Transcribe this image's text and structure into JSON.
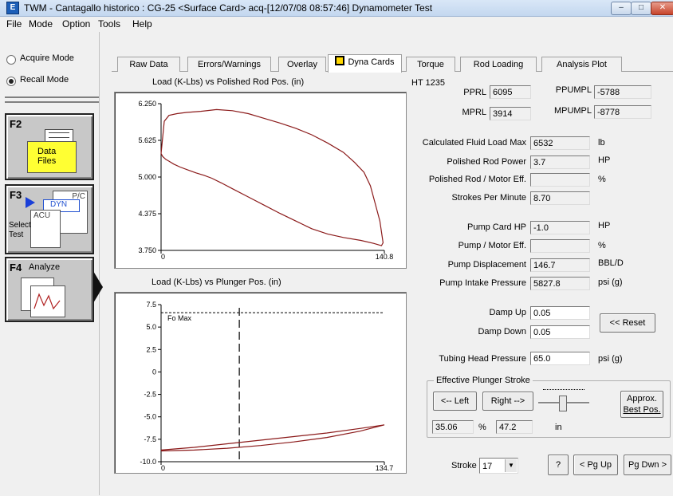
{
  "window": {
    "title": "TWM  -  Cantagallo historico : CG-25  <Surface Card>  acq-[12/07/08 08:57:46]  Dynamometer Test"
  },
  "menu": [
    "File",
    "Mode",
    "Option",
    "Tools",
    "Help"
  ],
  "left": {
    "acquire_label": "Acquire Mode",
    "recall_label": "Recall Mode",
    "f2_key": "F2",
    "f2_label_1": "Data",
    "f2_label_2": "Files",
    "f3_key": "F3",
    "f3_label_1": "Select",
    "f3_label_2": "Test",
    "f3_pc": "P/C",
    "f3_dyn": "DYN",
    "f3_acu": "ACU",
    "f4_key": "F4",
    "f4_label": "Analyze"
  },
  "tabs": [
    "Raw Data",
    "Errors/Warnings",
    "Overlay",
    "Dyna Cards",
    "Torque",
    "Rod Loading",
    "Analysis Plot"
  ],
  "plot1": {
    "title": "Load (K-Lbs) vs Polished Rod Pos. (in)"
  },
  "plot2": {
    "title": "Load (K-Lbs) vs Plunger Pos. (in)",
    "fo_label": "Fo Max"
  },
  "chart_data": [
    {
      "type": "line",
      "title": "Load (K-Lbs) vs Polished Rod Pos. (in)",
      "ylim": [
        3.75,
        6.25
      ],
      "xlim": [
        0,
        140.8
      ],
      "yticks": [
        "6.250",
        "5.625",
        "5.000",
        "4.375",
        "3.750"
      ],
      "xticks": [
        "0",
        "140.8"
      ],
      "color": "#8b1a1a",
      "series": [
        {
          "x": [
            0,
            2,
            5,
            10,
            16,
            25,
            35,
            45,
            55,
            65,
            75,
            85,
            95,
            105,
            115,
            122,
            128,
            132,
            135,
            138,
            140,
            139,
            134,
            126,
            115,
            105,
            95,
            85,
            75,
            65,
            55,
            45,
            38,
            32,
            27,
            22,
            17,
            12,
            8,
            5,
            3,
            1,
            0
          ],
          "y": [
            5.4,
            5.95,
            6.05,
            6.08,
            6.1,
            6.12,
            6.15,
            6.13,
            6.08,
            6.0,
            5.92,
            5.83,
            5.72,
            5.58,
            5.42,
            5.25,
            5.08,
            4.85,
            4.55,
            4.25,
            3.88,
            3.83,
            3.87,
            3.92,
            3.97,
            4.03,
            4.12,
            4.25,
            4.38,
            4.52,
            4.66,
            4.8,
            4.9,
            4.98,
            5.03,
            5.07,
            5.12,
            5.17,
            5.22,
            5.27,
            5.3,
            5.35,
            5.4
          ]
        }
      ]
    },
    {
      "type": "line",
      "title": "Load (K-Lbs) vs Plunger Pos. (in)",
      "ylim": [
        -10,
        7.5
      ],
      "xlim": [
        0,
        134.7
      ],
      "yticks": [
        "7.5",
        "5.0",
        "2.5",
        "0",
        "-2.5",
        "-5.0",
        "-7.5",
        "-10.0"
      ],
      "xticks": [
        "0",
        "134.7"
      ],
      "fo_max": 6.6,
      "stroke_marker_x": 47.2,
      "color": "#8b1a1a",
      "series": [
        {
          "x": [
            0,
            20,
            40,
            60,
            80,
            100,
            120,
            134.7,
            120,
            100,
            80,
            60,
            40,
            20,
            0
          ],
          "y": [
            -8.7,
            -8.4,
            -8.0,
            -7.6,
            -7.2,
            -6.8,
            -6.3,
            -5.9,
            -6.6,
            -7.3,
            -7.8,
            -8.2,
            -8.5,
            -8.7,
            -8.8
          ]
        }
      ]
    }
  ],
  "panel": {
    "ht": "HT 1235",
    "pprl_label": "PPRL",
    "pprl": "6095",
    "ppumpl_label": "PPUMPL",
    "ppumpl": "-5788",
    "mprl_label": "MPRL",
    "mprl": "3914",
    "mpumpl_label": "MPUMPL",
    "mpumpl": "-8778",
    "fluid_load_label": "Calculated Fluid Load Max",
    "fluid_load": "6532",
    "fluid_load_unit": "lb",
    "rod_power_label": "Polished Rod Power",
    "rod_power": "3.7",
    "rod_power_unit": "HP",
    "rod_motor_eff_label": "Polished Rod / Motor Eff.",
    "rod_motor_eff": "",
    "rod_motor_eff_unit": "%",
    "spm_label": "Strokes Per Minute",
    "spm": "8.70",
    "pump_hp_label": "Pump Card HP",
    "pump_hp": "-1.0",
    "pump_hp_unit": "HP",
    "pump_motor_eff_label": "Pump / Motor Eff.",
    "pump_motor_eff": "",
    "pump_motor_eff_unit": "%",
    "pump_disp_label": "Pump Displacement",
    "pump_disp": "146.7",
    "pump_disp_unit": "BBL/D",
    "pip_label": "Pump Intake Pressure",
    "pip": "5827.8",
    "pip_unit": "psi (g)",
    "damp_up_label": "Damp Up",
    "damp_up": "0.05",
    "damp_down_label": "Damp Down",
    "damp_down": "0.05",
    "reset_label": "<< Reset",
    "thp_label": "Tubing Head Pressure",
    "thp": "65.0",
    "thp_unit": "psi (g)",
    "eps_group_label": "Effective Plunger Stroke",
    "left_btn": "<-- Left",
    "right_btn": "Right -->",
    "approx_btn_1": "Approx.",
    "approx_btn_2": "Best Pos.",
    "eps_percent": "35.06",
    "eps_percent_unit": "%",
    "eps_inches": "47.2",
    "eps_inches_unit": "in",
    "stroke_label": "Stroke",
    "stroke_value": "17",
    "help_btn": "?",
    "pgup_btn": "< Pg Up",
    "pgdn_btn": "Pg Dwn >"
  }
}
